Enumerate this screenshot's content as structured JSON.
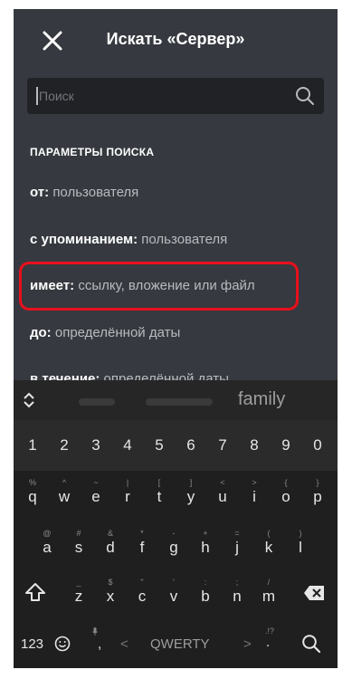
{
  "header": {
    "title": "Искать «Сервер»"
  },
  "search": {
    "placeholder": "Поиск"
  },
  "params": {
    "section_title": "ПАРАМЕТРЫ ПОИСКА",
    "options": [
      {
        "key": "от:",
        "value": "пользователя"
      },
      {
        "key": "с упоминанием:",
        "value": "пользователя"
      },
      {
        "key": "имеет:",
        "value": "ссылку, вложение или файл"
      },
      {
        "key": "до:",
        "value": "определённой даты"
      },
      {
        "key": "в течение:",
        "value": "определённой даты"
      }
    ]
  },
  "keyboard": {
    "suggestion": "family",
    "numbers": [
      "1",
      "2",
      "3",
      "4",
      "5",
      "6",
      "7",
      "8",
      "9",
      "0"
    ],
    "row1": {
      "keys": [
        "q",
        "w",
        "e",
        "r",
        "t",
        "y",
        "u",
        "i",
        "o",
        "p"
      ],
      "subs": [
        "%",
        "^",
        "~",
        "|",
        "[",
        "]",
        "<",
        ">",
        "{",
        "}"
      ]
    },
    "row2": {
      "keys": [
        "a",
        "s",
        "d",
        "f",
        "g",
        "h",
        "j",
        "k",
        "l"
      ],
      "subs": [
        "@",
        "#",
        "&",
        "*",
        "-",
        "+",
        "=",
        "(",
        ")"
      ]
    },
    "row3": {
      "keys": [
        "z",
        "x",
        "c",
        "v",
        "b",
        "n",
        "m"
      ],
      "subs": [
        "_",
        "$",
        "\"",
        "'",
        ":",
        ";",
        "/"
      ]
    },
    "bottom": {
      "num_label": "123",
      "space_label": "QWERTY",
      "comma": ",",
      "period": ".",
      "left_arrow": "<",
      "right_arrow": ">"
    }
  },
  "colors": {
    "background": "#36393f",
    "highlight": "#e8101c",
    "keyboard": "#1f1f1f"
  }
}
